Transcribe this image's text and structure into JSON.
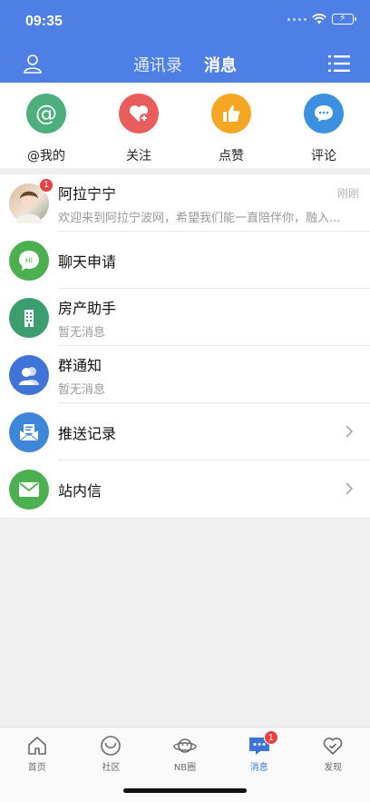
{
  "status_bar": {
    "time": "09:35"
  },
  "header": {
    "tabs": [
      {
        "label": "通讯录",
        "active": false
      },
      {
        "label": "消息",
        "active": true
      }
    ]
  },
  "quick_actions": [
    {
      "label": "@我的",
      "icon": "at-icon",
      "color": "#4caf7d"
    },
    {
      "label": "关注",
      "icon": "heart-plus-icon",
      "color": "#ea5d5d"
    },
    {
      "label": "点赞",
      "icon": "thumbs-up-icon",
      "color": "#f5a623"
    },
    {
      "label": "评论",
      "icon": "comment-bubble-icon",
      "color": "#3d8fe0"
    }
  ],
  "messages": [
    {
      "title": "阿拉宁宁",
      "subtitle": "欢迎来到阿拉宁波网，希望我们能一直陪伴你，融入...",
      "time": "刚刚",
      "badge": "1"
    },
    {
      "title": "聊天申请",
      "subtitle": "",
      "icon_text": "HI"
    },
    {
      "title": "房产助手",
      "subtitle": "暂无消息"
    },
    {
      "title": "群通知",
      "subtitle": "暂无消息"
    },
    {
      "title": "推送记录",
      "subtitle": ""
    },
    {
      "title": "站内信",
      "subtitle": ""
    }
  ],
  "tabbar": [
    {
      "label": "首页",
      "icon": "home-icon",
      "active": false
    },
    {
      "label": "社区",
      "icon": "community-icon",
      "active": false
    },
    {
      "label": "NB圈",
      "icon": "planet-icon",
      "active": false
    },
    {
      "label": "消息",
      "icon": "message-icon",
      "active": true,
      "badge": "1"
    },
    {
      "label": "发现",
      "icon": "discover-heart-icon",
      "active": false
    }
  ],
  "colors": {
    "header_bg": "#4e7fe4",
    "accent": "#3f73d8",
    "badge": "#e84040"
  }
}
